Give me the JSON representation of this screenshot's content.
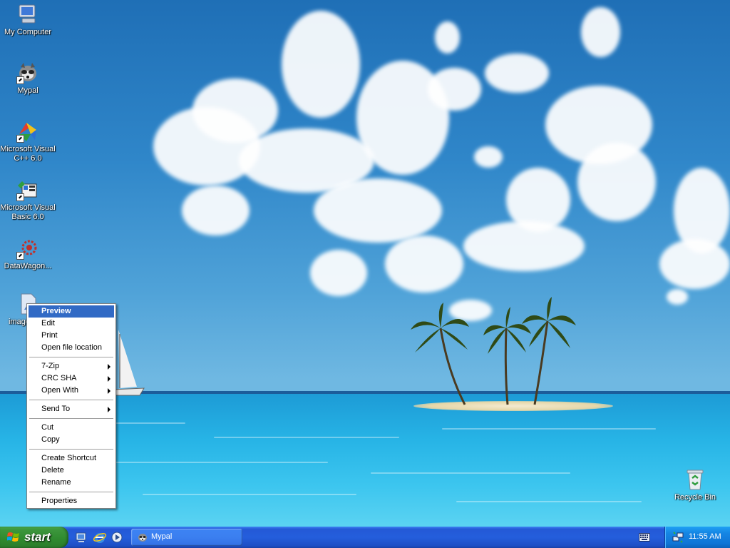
{
  "desktop": {
    "icons": [
      {
        "label": "My Computer",
        "icon": "my-computer-icon"
      },
      {
        "label": "Mypal",
        "icon": "mypal-raccoon-icon"
      },
      {
        "label": "Microsoft Visual C++ 6.0",
        "icon": "visual-cpp-icon"
      },
      {
        "label": "Microsoft Visual Basic 6.0",
        "icon": "visual-basic-icon"
      },
      {
        "label": "DataWagon...",
        "icon": "datawagon-icon"
      },
      {
        "label": "image",
        "icon": "image-file-icon"
      }
    ],
    "recycle_bin": {
      "label": "Recycle Bin",
      "icon": "recycle-bin-icon"
    }
  },
  "context_menu": {
    "items": [
      {
        "label": "Preview"
      },
      {
        "label": "Edit"
      },
      {
        "label": "Print"
      },
      {
        "label": "Open file location"
      },
      {
        "label": "7-Zip"
      },
      {
        "label": "CRC SHA"
      },
      {
        "label": "Open With"
      },
      {
        "label": "Send To"
      },
      {
        "label": "Cut"
      },
      {
        "label": "Copy"
      },
      {
        "label": "Create Shortcut"
      },
      {
        "label": "Delete"
      },
      {
        "label": "Rename"
      },
      {
        "label": "Properties"
      }
    ]
  },
  "taskbar": {
    "start_label": "start",
    "quick_launch": [
      "show-desktop-icon",
      "internet-explorer-icon",
      "media-player-icon"
    ],
    "tasks": [
      {
        "label": "Mypal"
      }
    ],
    "clock": "11:55 AM"
  },
  "colors": {
    "taskbar_blue": "#245edc",
    "start_green": "#3c963c",
    "menu_highlight": "#316ac5",
    "tray_blue": "#0f74d6"
  }
}
